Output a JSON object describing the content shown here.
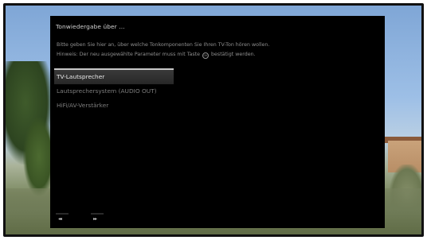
{
  "dialog": {
    "title": "Tonwiedergabe über ...",
    "description_line1": "Bitte geben Sie hier an, über welche Tonkomponenten Sie Ihren TV-Ton hören wollen.",
    "description_line2_before": "Hinweis: Der neu ausgewählte Parameter muss mit Taste",
    "description_line2_after": "bestätigt werden.",
    "ok_key_icon": "ok-button-circle-icon",
    "options": [
      {
        "label": "TV-Lautsprecher",
        "selected": true
      },
      {
        "label": "Lautsprechersystem (AUDIO OUT)",
        "selected": false
      },
      {
        "label": "HiFi/AV-Verstärker",
        "selected": false
      }
    ]
  },
  "footer": {
    "hints": [
      {
        "icon": "rewind-icon",
        "glyph": "◂◂"
      },
      {
        "icon": "fast-forward-icon",
        "glyph": "▸▸"
      }
    ]
  },
  "colors": {
    "dialog_background": "#000000",
    "selected_item_background": "#333333",
    "selected_text": "#e8e8e8",
    "normal_text": "#7d7d7d"
  }
}
